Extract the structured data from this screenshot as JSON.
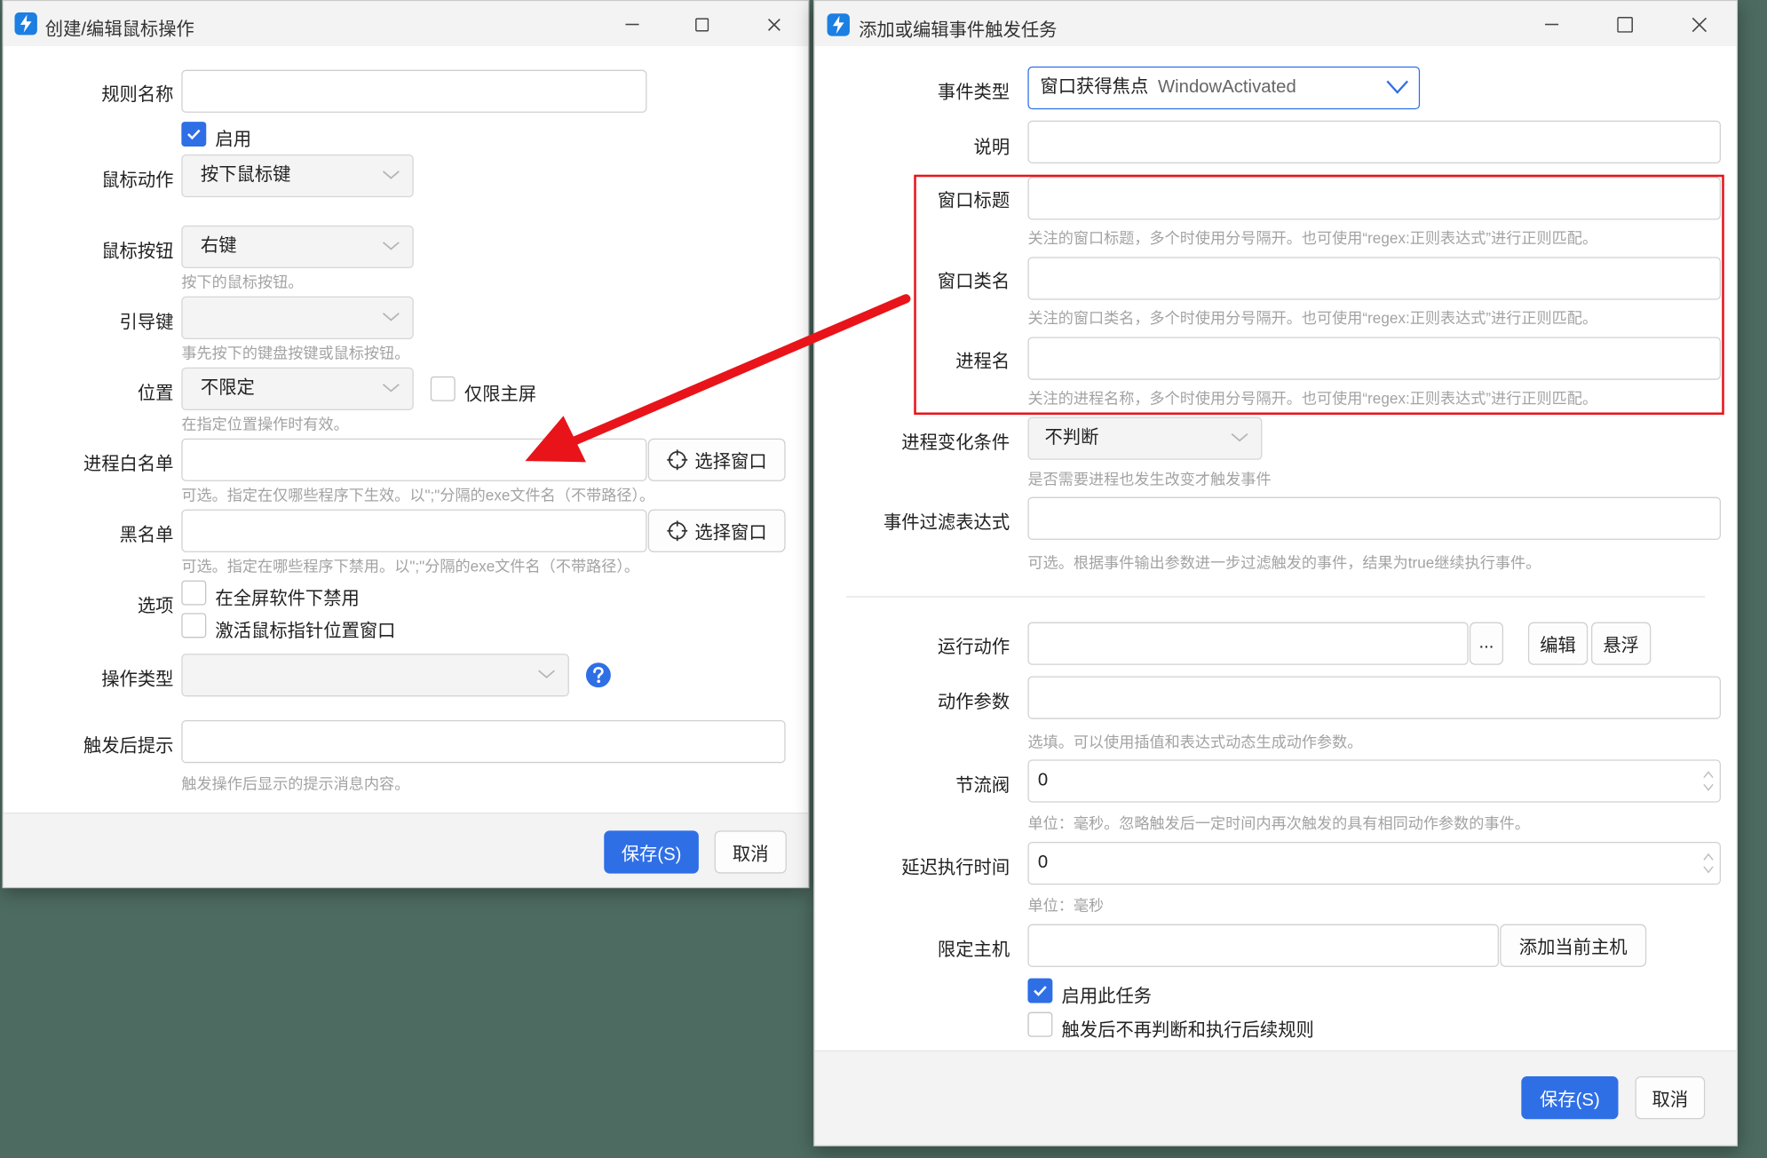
{
  "left": {
    "title": "创建/编辑鼠标操作",
    "rule_name": {
      "label": "规则名称",
      "value": ""
    },
    "enable": {
      "label": "启用",
      "checked": true
    },
    "mouse_action": {
      "label": "鼠标动作",
      "value": "按下鼠标键"
    },
    "mouse_button": {
      "label": "鼠标按钮",
      "value": "右键",
      "hint": "按下的鼠标按钮。"
    },
    "lead_key": {
      "label": "引导键",
      "value": "",
      "hint": "事先按下的键盘按键或鼠标按钮。"
    },
    "position": {
      "label": "位置",
      "value": "不限定",
      "hint": "在指定位置操作时有效。",
      "main_screen_label": "仅限主屏",
      "main_screen_checked": false
    },
    "whitelist": {
      "label": "进程白名单",
      "value": "",
      "button": "选择窗口",
      "hint": "可选。指定在仅哪些程序下生效。以\";\"分隔的exe文件名（不带路径）。"
    },
    "blacklist": {
      "label": "黑名单",
      "value": "",
      "button": "选择窗口",
      "hint": "可选。指定在哪些程序下禁用。以\";\"分隔的exe文件名（不带路径）。"
    },
    "options": {
      "label": "选项",
      "opt1": "在全屏软件下禁用",
      "opt2": "激活鼠标指针位置窗口"
    },
    "op_type": {
      "label": "操作类型",
      "value": ""
    },
    "trigger_tip": {
      "label": "触发后提示",
      "value": "",
      "hint": "触发操作后显示的提示消息内容。"
    },
    "save": "保存(S)",
    "cancel": "取消"
  },
  "right": {
    "title": "添加或编辑事件触发任务",
    "event_type": {
      "label": "事件类型",
      "value": "窗口获得焦点",
      "value_en": "WindowActivated"
    },
    "desc": {
      "label": "说明",
      "value": ""
    },
    "win_title": {
      "label": "窗口标题",
      "value": "",
      "hint": "关注的窗口标题，多个时使用分号隔开。也可使用“regex:正则表达式”进行正则匹配。"
    },
    "win_class": {
      "label": "窗口类名",
      "value": "",
      "hint": "关注的窗口类名，多个时使用分号隔开。也可使用“regex:正则表达式”进行正则匹配。"
    },
    "proc_name": {
      "label": "进程名",
      "value": "",
      "hint": "关注的进程名称，多个时使用分号隔开。也可使用“regex:正则表达式”进行正则匹配。"
    },
    "proc_change": {
      "label": "进程变化条件",
      "value": "不判断",
      "hint": "是否需要进程也发生改变才触发事件"
    },
    "filter": {
      "label": "事件过滤表达式",
      "value": "",
      "hint": "可选。根据事件输出参数进一步过滤触发的事件，结果为true继续执行事件。"
    },
    "run_action": {
      "label": "运行动作",
      "value": "",
      "dots": "...",
      "edit": "编辑",
      "float": "悬浮"
    },
    "action_params": {
      "label": "动作参数",
      "value": "",
      "hint": "选填。可以使用插值和表达式动态生成动作参数。"
    },
    "throttle": {
      "label": "节流阀",
      "value": "0",
      "hint": "单位：毫秒。忽略触发后一定时间内再次触发的具有相同动作参数的事件。"
    },
    "delay": {
      "label": "延迟执行时间",
      "value": "0",
      "hint": "单位：毫秒"
    },
    "host": {
      "label": "限定主机",
      "value": "",
      "button": "添加当前主机"
    },
    "enable_task": {
      "label": "启用此任务",
      "checked": true
    },
    "stop_after": {
      "label": "触发后不再判断和执行后续规则",
      "checked": false
    },
    "save": "保存(S)",
    "cancel": "取消"
  },
  "colors": {
    "accent": "#2f6fe6",
    "annotation": "#e8141a",
    "desktop": "#4d6b61"
  },
  "icons": [
    "app-icon",
    "minimize-icon",
    "maximize-icon",
    "close-icon",
    "chevron-down-icon",
    "crosshair-icon",
    "help-icon",
    "check-icon",
    "spinner-icon"
  ]
}
